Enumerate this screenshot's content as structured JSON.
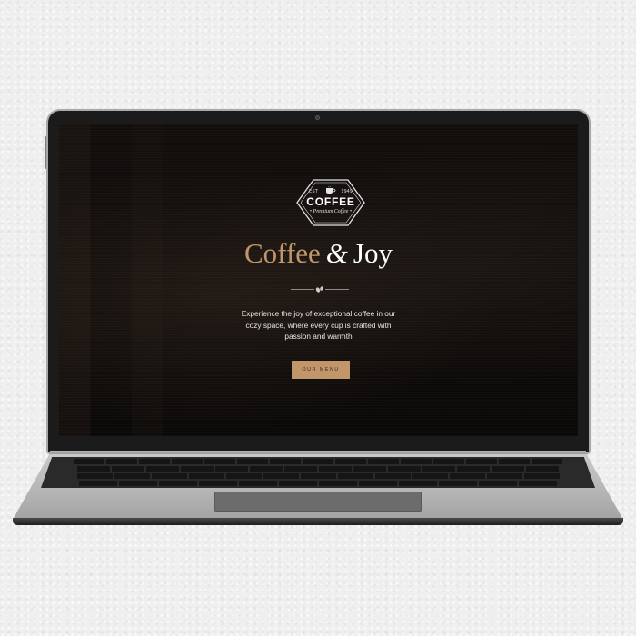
{
  "site": {
    "logo": {
      "est": "EST",
      "year": "1949",
      "word": "COFFEE",
      "tagline": "• Premium Coffee •",
      "icon": "coffee-cup-icon"
    },
    "headline": {
      "word1": "Coffee",
      "amp": "&",
      "word2": "Joy"
    },
    "divider_icon": "coffee-beans-icon",
    "description": "Experience the joy of exceptional coffee in our cozy space, where every cup is crafted with passion and warmth",
    "cta_label": "OUR MENU"
  },
  "colors": {
    "accent": "#c2956a",
    "background": "#0d0b0a",
    "text": "#ffffff"
  }
}
